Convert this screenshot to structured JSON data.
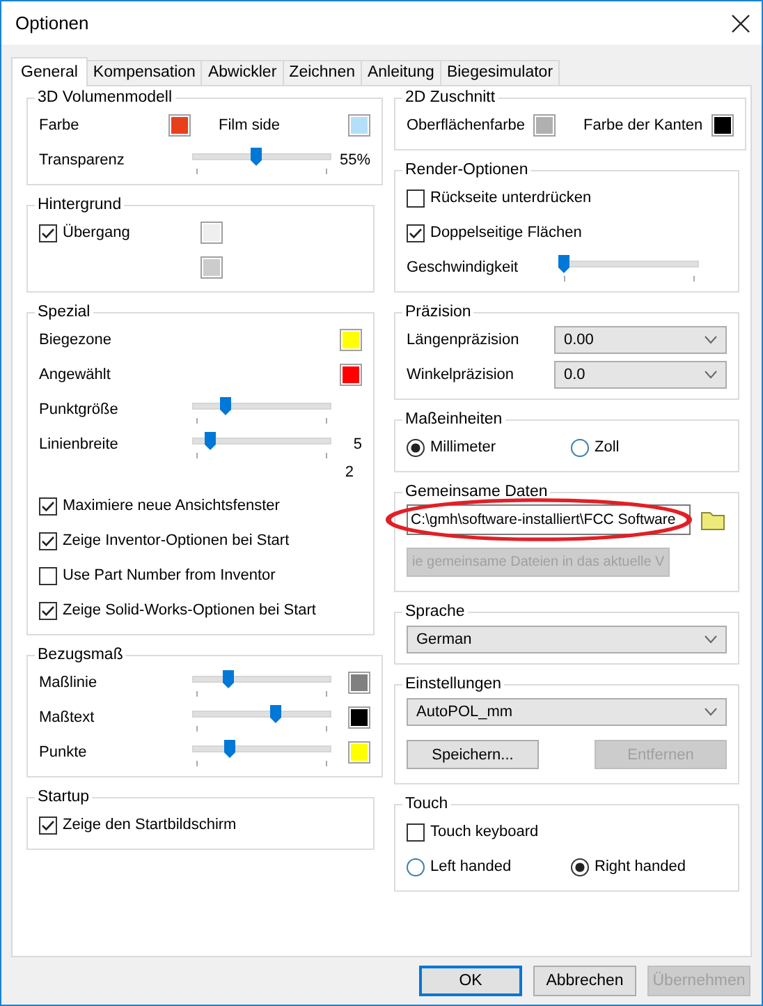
{
  "window": {
    "title": "Optionen"
  },
  "tabs": [
    {
      "label": "General",
      "selected": true
    },
    {
      "label": "Kompensation",
      "selected": false
    },
    {
      "label": "Abwickler",
      "selected": false
    },
    {
      "label": "Zeichnen",
      "selected": false
    },
    {
      "label": "Anleitung",
      "selected": false
    },
    {
      "label": "Biegesimulator",
      "selected": false
    }
  ],
  "left_groups": [
    {
      "title": "3D Volumenmodell",
      "items": [
        {
          "kind": "colors",
          "entries": [
            {
              "label": "Farbe",
              "color": "#e8401c"
            },
            {
              "label": "Film side",
              "color": "#b3e0f8"
            }
          ]
        },
        {
          "kind": "slider",
          "label": "Transparenz",
          "level": 0.46,
          "reading": "55%"
        }
      ]
    },
    {
      "title": "Hintergrund",
      "items": [
        {
          "kind": "checkbox",
          "label": "Übergang",
          "checked": true,
          "color": "#efefef"
        },
        {
          "kind": "swatch",
          "color": "#cccccc"
        }
      ]
    },
    {
      "title": "Spezial",
      "items": [
        {
          "kind": "colors",
          "entries": [
            {
              "label": "Biegezone",
              "color": "#ffff00"
            }
          ]
        },
        {
          "kind": "colors",
          "entries": [
            {
              "label": "Angewählt",
              "color": "#ff0000"
            }
          ]
        },
        {
          "kind": "slider",
          "label": "Punktgröße",
          "level": 0.24
        },
        {
          "kind": "slider",
          "label": "Linienbreite",
          "level": 0.13,
          "reading": "5"
        },
        {
          "kind": "text",
          "label": "2"
        },
        {
          "kind": "checkbox",
          "label": "Maximiere neue Ansichtsfenster",
          "checked": true
        },
        {
          "kind": "checkbox",
          "label": "Zeige Inventor-Optionen bei Start",
          "checked": true
        },
        {
          "kind": "checkbox",
          "label": "Use Part Number from Inventor",
          "checked": false
        },
        {
          "kind": "checkbox",
          "label": "Zeige Solid-Works-Optionen bei Start",
          "checked": true
        }
      ]
    },
    {
      "title": "Bezugsmaß",
      "items": [
        {
          "kind": "slider",
          "label": "Maßlinie",
          "level": 0.26,
          "color": "#808080"
        },
        {
          "kind": "slider",
          "label": "Maßtext",
          "level": 0.6,
          "color": "#000000"
        },
        {
          "kind": "slider",
          "label": "Punkte",
          "level": 0.27,
          "color": "#ffff00"
        }
      ]
    },
    {
      "title": "Startup",
      "items": [
        {
          "kind": "checkbox",
          "label": "Zeige den Startbildschirm",
          "checked": true
        }
      ]
    }
  ],
  "right_groups": [
    {
      "title": "2D Zuschnitt",
      "items": [
        {
          "kind": "colors",
          "entries": [
            {
              "label": "Oberflächenfarbe",
              "color": "#b0b0b0"
            },
            {
              "label": "Farbe der Kanten",
              "color": "#000000"
            }
          ]
        }
      ]
    },
    {
      "title": "Render-Optionen",
      "items": [
        {
          "kind": "checkbox",
          "label": "Rückseite unterdrücken",
          "checked": false
        },
        {
          "kind": "checkbox",
          "label": "Doppelseitige Flächen",
          "checked": true
        },
        {
          "kind": "slider",
          "label": "Geschwindigkeit",
          "level": 0.03
        }
      ]
    },
    {
      "title": "Präzision",
      "items": [
        {
          "kind": "select",
          "label": "Längenpräzision",
          "value": "0.00"
        },
        {
          "kind": "select",
          "label": "Winkelpräzision",
          "value": "0.0"
        }
      ]
    },
    {
      "title": "Maßeinheiten",
      "items": [
        {
          "kind": "radios",
          "options": [
            {
              "label": "Millimeter",
              "selected": true
            },
            {
              "label": "Zoll",
              "selected": false
            }
          ]
        }
      ]
    },
    {
      "title": "Gemeinsame Daten",
      "items": [
        {
          "kind": "path",
          "value": "C:\\gmh\\software-installiert\\FCC Software"
        },
        {
          "kind": "buttons",
          "buttons": [
            {
              "label": "ie gemeinsame Dateien in das aktuelle V",
              "disabled": true
            }
          ]
        }
      ]
    },
    {
      "title": "Sprache",
      "items": [
        {
          "kind": "select",
          "value": "German"
        }
      ]
    },
    {
      "title": "Einstellungen",
      "items": [
        {
          "kind": "select",
          "value": "AutoPOL_mm"
        },
        {
          "kind": "buttons",
          "buttons": [
            {
              "label": "Speichern...",
              "disabled": false
            },
            {
              "label": "Entfernen",
              "disabled": true
            }
          ]
        }
      ]
    },
    {
      "title": "Touch",
      "items": [
        {
          "kind": "checkbox",
          "label": "Touch keyboard",
          "checked": false
        },
        {
          "kind": "radios",
          "options": [
            {
              "label": "Left handed",
              "selected": false
            },
            {
              "label": "Right handed",
              "selected": true
            }
          ]
        }
      ]
    }
  ],
  "footer_buttons": [
    {
      "label": "OK",
      "disabled": false,
      "default": true
    },
    {
      "label": "Abbrechen",
      "disabled": false,
      "default": false
    },
    {
      "label": "Übernehmen",
      "disabled": true,
      "default": false
    }
  ]
}
